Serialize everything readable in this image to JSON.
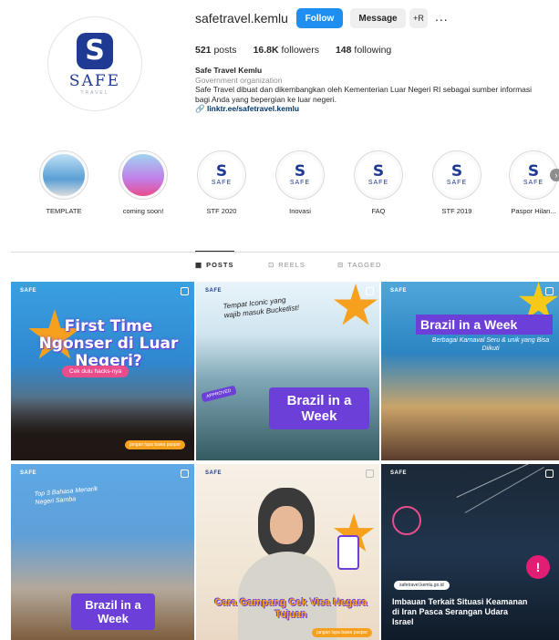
{
  "profile": {
    "username": "safetravel.kemlu",
    "buttons": {
      "follow": "Follow",
      "message": "Message",
      "suggest": "+R",
      "more": "..."
    },
    "stats": {
      "posts": "521",
      "posts_label": "posts",
      "followers": "16.8K",
      "followers_label": "followers",
      "following": "148",
      "following_label": "following"
    },
    "name": "Safe Travel Kemlu",
    "category": "Government organization",
    "bio_line1": "Safe Travel dibuat dan dikembangkan oleh Kementerian Luar Negeri RI sebagai sumber informasi",
    "bio_line2": "bagi Anda yang bepergian ke luar negeri.",
    "link": "linktr.ee/safetravel.kemlu",
    "avatar": {
      "mark": "S",
      "word": "SAFE",
      "sub": "TRAVEL"
    }
  },
  "highlights": [
    {
      "label": "TEMPLATE"
    },
    {
      "label": "coming soon!"
    },
    {
      "label": "STF 2020",
      "logo_s": "S",
      "logo_w": "SAFE"
    },
    {
      "label": "Inovasi",
      "logo_s": "S",
      "logo_w": "SAFE"
    },
    {
      "label": "FAQ",
      "logo_s": "S",
      "logo_w": "SAFE"
    },
    {
      "label": "STF 2019",
      "logo_s": "S",
      "logo_w": "SAFE"
    },
    {
      "label": "Paspor Hilan...",
      "logo_s": "S",
      "logo_w": "SAFE"
    }
  ],
  "tabs": {
    "posts": "POSTS",
    "reels": "REELS",
    "tagged": "TAGGED"
  },
  "posts": {
    "brand": "SAFE",
    "p1": {
      "headline": "First Time Ngonser di Luar Negeri?",
      "pill": "Cek dulu hacks-nya",
      "foot": "jangan lupa bawa paspor"
    },
    "p2": {
      "note": "Tempat Iconic yang wajib masuk Bucketlist!",
      "big": "Brazil in a Week",
      "stamp": "APPROVED"
    },
    "p3": {
      "title": "Brazil in a Week",
      "sub": "Berbagai Karnaval Seru & unik yang Bisa Diikuti"
    },
    "p4": {
      "note": "Top 3 Bahasa Menarik Negeri Samba",
      "big": "Brazil in a Week"
    },
    "p5": {
      "headline": "Cara Gampang Cek Visa Negara Tujuan",
      "foot": "jangan lupa bawa paspor"
    },
    "p6": {
      "pill": "safetravel.kemlu.go.id",
      "alert": "!",
      "text": "Imbauan Terkait Situasi Keamanan di Iran Pasca Serangan Udara Israel"
    }
  }
}
